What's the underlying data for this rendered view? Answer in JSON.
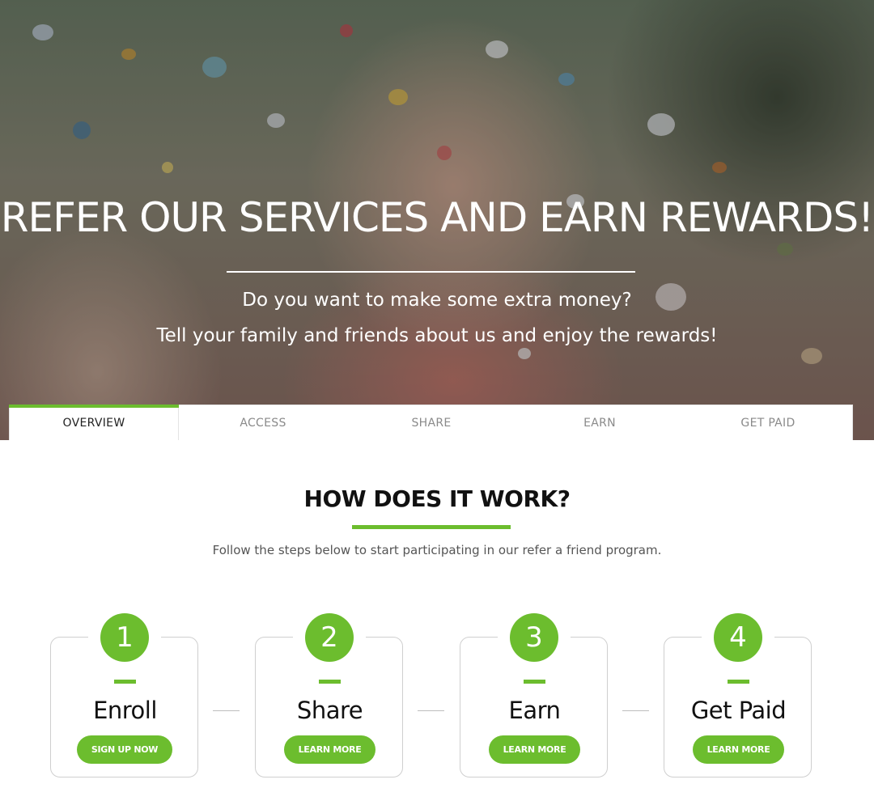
{
  "hero": {
    "title": "REFER OUR SERVICES AND EARN REWARDS!",
    "subtitle_line1": "Do you want to make some extra money?",
    "subtitle_line2": "Tell your family and friends about us and enjoy the rewards!"
  },
  "tabs": [
    {
      "label": "OVERVIEW",
      "active": true
    },
    {
      "label": "ACCESS",
      "active": false
    },
    {
      "label": "SHARE",
      "active": false
    },
    {
      "label": "EARN",
      "active": false
    },
    {
      "label": "GET PAID",
      "active": false
    }
  ],
  "how": {
    "title": "HOW DOES IT WORK?",
    "description": "Follow the steps below to start participating in our refer a friend program."
  },
  "steps": [
    {
      "number": "1",
      "label": "Enroll",
      "button": "SIGN UP NOW"
    },
    {
      "number": "2",
      "label": "Share",
      "button": "LEARN MORE"
    },
    {
      "number": "3",
      "label": "Earn",
      "button": "LEARN MORE"
    },
    {
      "number": "4",
      "label": "Get Paid",
      "button": "LEARN MORE"
    }
  ],
  "colors": {
    "accent": "#6cbd2e",
    "text": "#111111",
    "muted": "#8a8a8a"
  }
}
